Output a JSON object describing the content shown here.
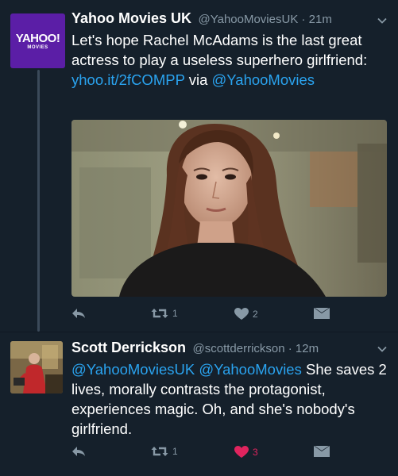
{
  "colors": {
    "background": "#15202b",
    "link": "#2aa3ef",
    "muted": "#8899a6",
    "like_active": "#e0245e",
    "yahoo_purple": "#5b1ea6"
  },
  "tweets": [
    {
      "avatar": {
        "brand": "YAHOO!",
        "sub": "MOVIES",
        "icon": "yahoo-movies-logo"
      },
      "name": "Yahoo Movies UK",
      "handle": "@YahooMoviesUK · 21m",
      "text_before": "Let's hope Rachel McAdams is the last great actress to play a useless superhero girlfriend: ",
      "link_url": "yhoo.it/2fCOMPP",
      "text_mid": " via ",
      "link_mention": "@YahooMovies",
      "actions": {
        "reply": "",
        "retweet": "1",
        "like": "2"
      }
    },
    {
      "name": "Scott Derrickson",
      "handle": "@scottderrickson · 12m",
      "mention1": "@YahooMoviesUK",
      "mention2": "@YahooMovies",
      "text_after": " She saves 2 lives, morally contrasts the protagonist, experiences magic. Oh, and she's nobody's girlfriend.",
      "actions": {
        "reply": "",
        "retweet": "1",
        "like": "3"
      }
    }
  ]
}
